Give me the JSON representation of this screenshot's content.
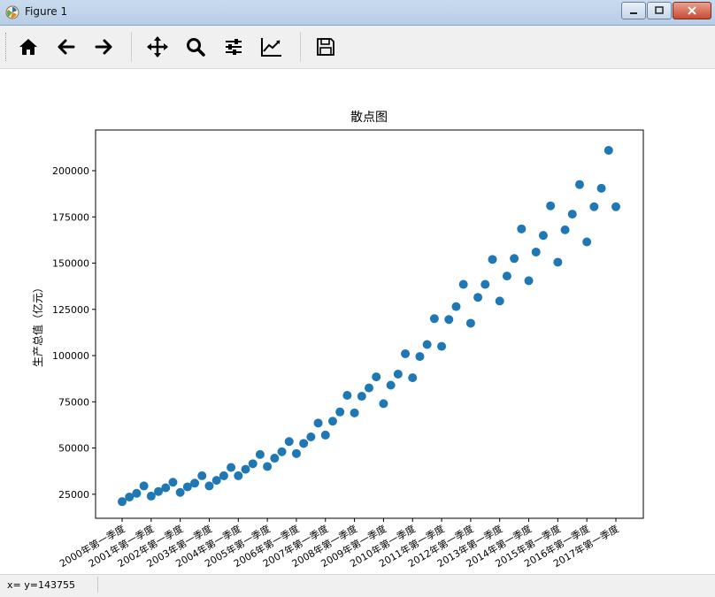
{
  "window": {
    "title": "Figure 1"
  },
  "toolbar": {
    "buttons": [
      {
        "name": "home-icon"
      },
      {
        "name": "back-arrow-icon"
      },
      {
        "name": "forward-arrow-icon"
      },
      {
        "name": "pan-icon"
      },
      {
        "name": "zoom-icon"
      },
      {
        "name": "configure-subplots-icon"
      },
      {
        "name": "edit-axis-icon"
      },
      {
        "name": "save-icon"
      }
    ]
  },
  "status": {
    "coords": "x= y=143755"
  },
  "chart_data": {
    "type": "scatter",
    "title": "散点图",
    "xlabel": "",
    "ylabel": "生产总值（亿元）",
    "color": "#1f77b4",
    "ylim": [
      12000,
      222000
    ],
    "yticks": [
      25000,
      50000,
      75000,
      100000,
      125000,
      150000,
      175000,
      200000
    ],
    "ytick_labels": [
      "25000",
      "50000",
      "75000",
      "100000",
      "125000",
      "150000",
      "175000",
      "200000"
    ],
    "xtick_labels": [
      "2000年第一季度",
      "2001年第一季度",
      "2002年第一季度",
      "2003年第一季度",
      "2004年第一季度",
      "2005年第一季度",
      "2006年第一季度",
      "2007年第一季度",
      "2008年第一季度",
      "2009年第一季度",
      "2010年第一季度",
      "2011年第一季度",
      "2012年第一季度",
      "2013年第一季度",
      "2014年第一季度",
      "2015年第一季度",
      "2016年第一季度",
      "2017年第一季度"
    ],
    "grid": false,
    "values": [
      21000,
      23500,
      25500,
      29500,
      24000,
      26500,
      28500,
      31500,
      26000,
      29000,
      31000,
      35000,
      29500,
      32500,
      35000,
      39500,
      35000,
      38500,
      41500,
      46500,
      40000,
      44500,
      48000,
      53500,
      47000,
      52500,
      56000,
      63500,
      57000,
      64500,
      69500,
      78500,
      69000,
      78000,
      82500,
      88500,
      74000,
      84000,
      90000,
      101000,
      88000,
      99500,
      106000,
      120000,
      105000,
      119500,
      126500,
      138500,
      117500,
      131500,
      138500,
      152000,
      129500,
      143000,
      152500,
      168500,
      140500,
      156000,
      165000,
      181000,
      150500,
      168000,
      176500,
      192500,
      161500,
      180500,
      190500,
      211000,
      180500
    ]
  }
}
